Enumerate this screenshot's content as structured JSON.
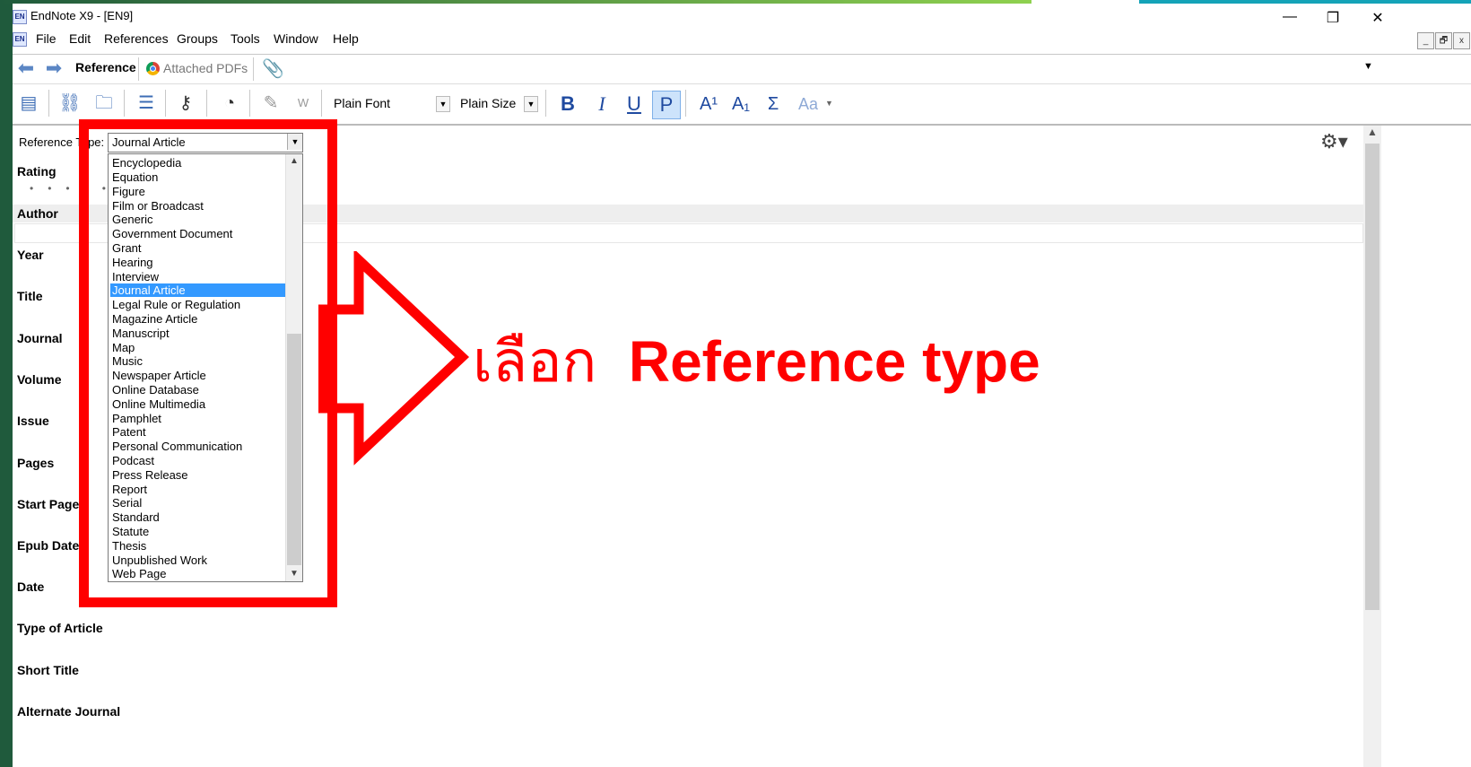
{
  "window": {
    "title": "EndNote X9 - [EN9]",
    "app_icon": "EN",
    "controls": [
      "—",
      "❐",
      "✕"
    ]
  },
  "menu": {
    "items": [
      "File",
      "Edit",
      "References",
      "Groups",
      "Tools",
      "Window",
      "Help"
    ],
    "mdi_controls": [
      "_",
      "🗗",
      "x"
    ]
  },
  "tabs": {
    "reference": "Reference",
    "attached_pdfs": "Attached PDFs",
    "expand_icon": "▼"
  },
  "toolbar": {
    "font": "Plain Font",
    "size": "Plain Size",
    "bold": "B",
    "italic": "I",
    "underline": "U",
    "plain": "P",
    "superscript": "A¹",
    "subscript": "A₁",
    "symbol": "Σ",
    "case": "Aa"
  },
  "form": {
    "reftype_label": "Reference Type:",
    "reftype_value": "Journal Article",
    "fields": [
      "Rating",
      "Author",
      "Year",
      "Title",
      "Journal",
      "Volume",
      "Issue",
      "Pages",
      "Start Page",
      "Epub Date",
      "Date",
      "Type of Article",
      "Short Title",
      "Alternate Journal"
    ]
  },
  "dropdown": {
    "options": [
      "Encyclopedia",
      "Equation",
      "Figure",
      "Film or Broadcast",
      "Generic",
      "Government Document",
      "Grant",
      "Hearing",
      "Interview",
      "Journal Article",
      "Legal Rule or Regulation",
      "Magazine Article",
      "Manuscript",
      "Map",
      "Music",
      "Newspaper Article",
      "Online Database",
      "Online Multimedia",
      "Pamphlet",
      "Patent",
      "Personal Communication",
      "Podcast",
      "Press Release",
      "Report",
      "Serial",
      "Standard",
      "Statute",
      "Thesis",
      "Unpublished Work",
      "Web Page"
    ],
    "selected": "Journal Article"
  },
  "annotation": {
    "thai": "เลือก",
    "english": "Reference type",
    "color": "#ff0000"
  }
}
